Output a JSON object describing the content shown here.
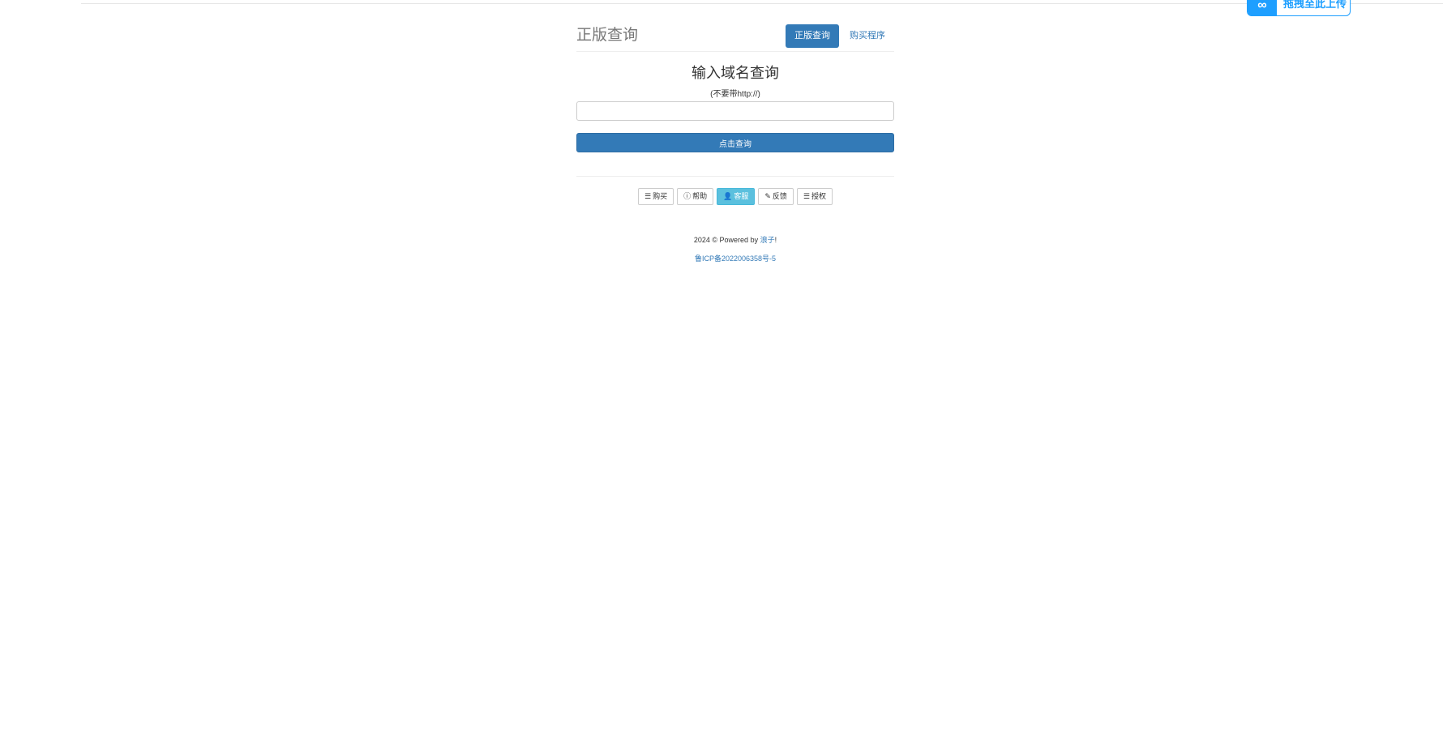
{
  "float_upload": {
    "label": "拖拽至此上传",
    "icon": "infinity-icon"
  },
  "header": {
    "brand": "正版查询",
    "nav": [
      {
        "label": "正版查询",
        "active": true
      },
      {
        "label": "购买程序",
        "active": false
      }
    ]
  },
  "query": {
    "title": "输入域名查询",
    "hint": "(不要带http://)",
    "input_value": "",
    "input_placeholder": "",
    "submit_label": "点击查询"
  },
  "buttons": [
    {
      "icon": "list-icon",
      "glyph": "☰",
      "label": "购买",
      "style": "default"
    },
    {
      "icon": "info-icon",
      "glyph": "ⓘ",
      "label": "帮助",
      "style": "default"
    },
    {
      "icon": "user-icon",
      "glyph": "👤",
      "label": "客服",
      "style": "info"
    },
    {
      "icon": "pencil-icon",
      "glyph": "✎",
      "label": "反馈",
      "style": "default"
    },
    {
      "icon": "list-icon",
      "glyph": "☰",
      "label": "授权",
      "style": "default"
    }
  ],
  "footer": {
    "copyright_prefix": "2024 © Powered by ",
    "author_link": "浪子",
    "copyright_suffix": "!",
    "icp": "鲁ICP备2022006358号-5"
  },
  "colors": {
    "primary": "#337ab7",
    "info": "#5bc0de",
    "upload_accent": "#1e9fff"
  }
}
